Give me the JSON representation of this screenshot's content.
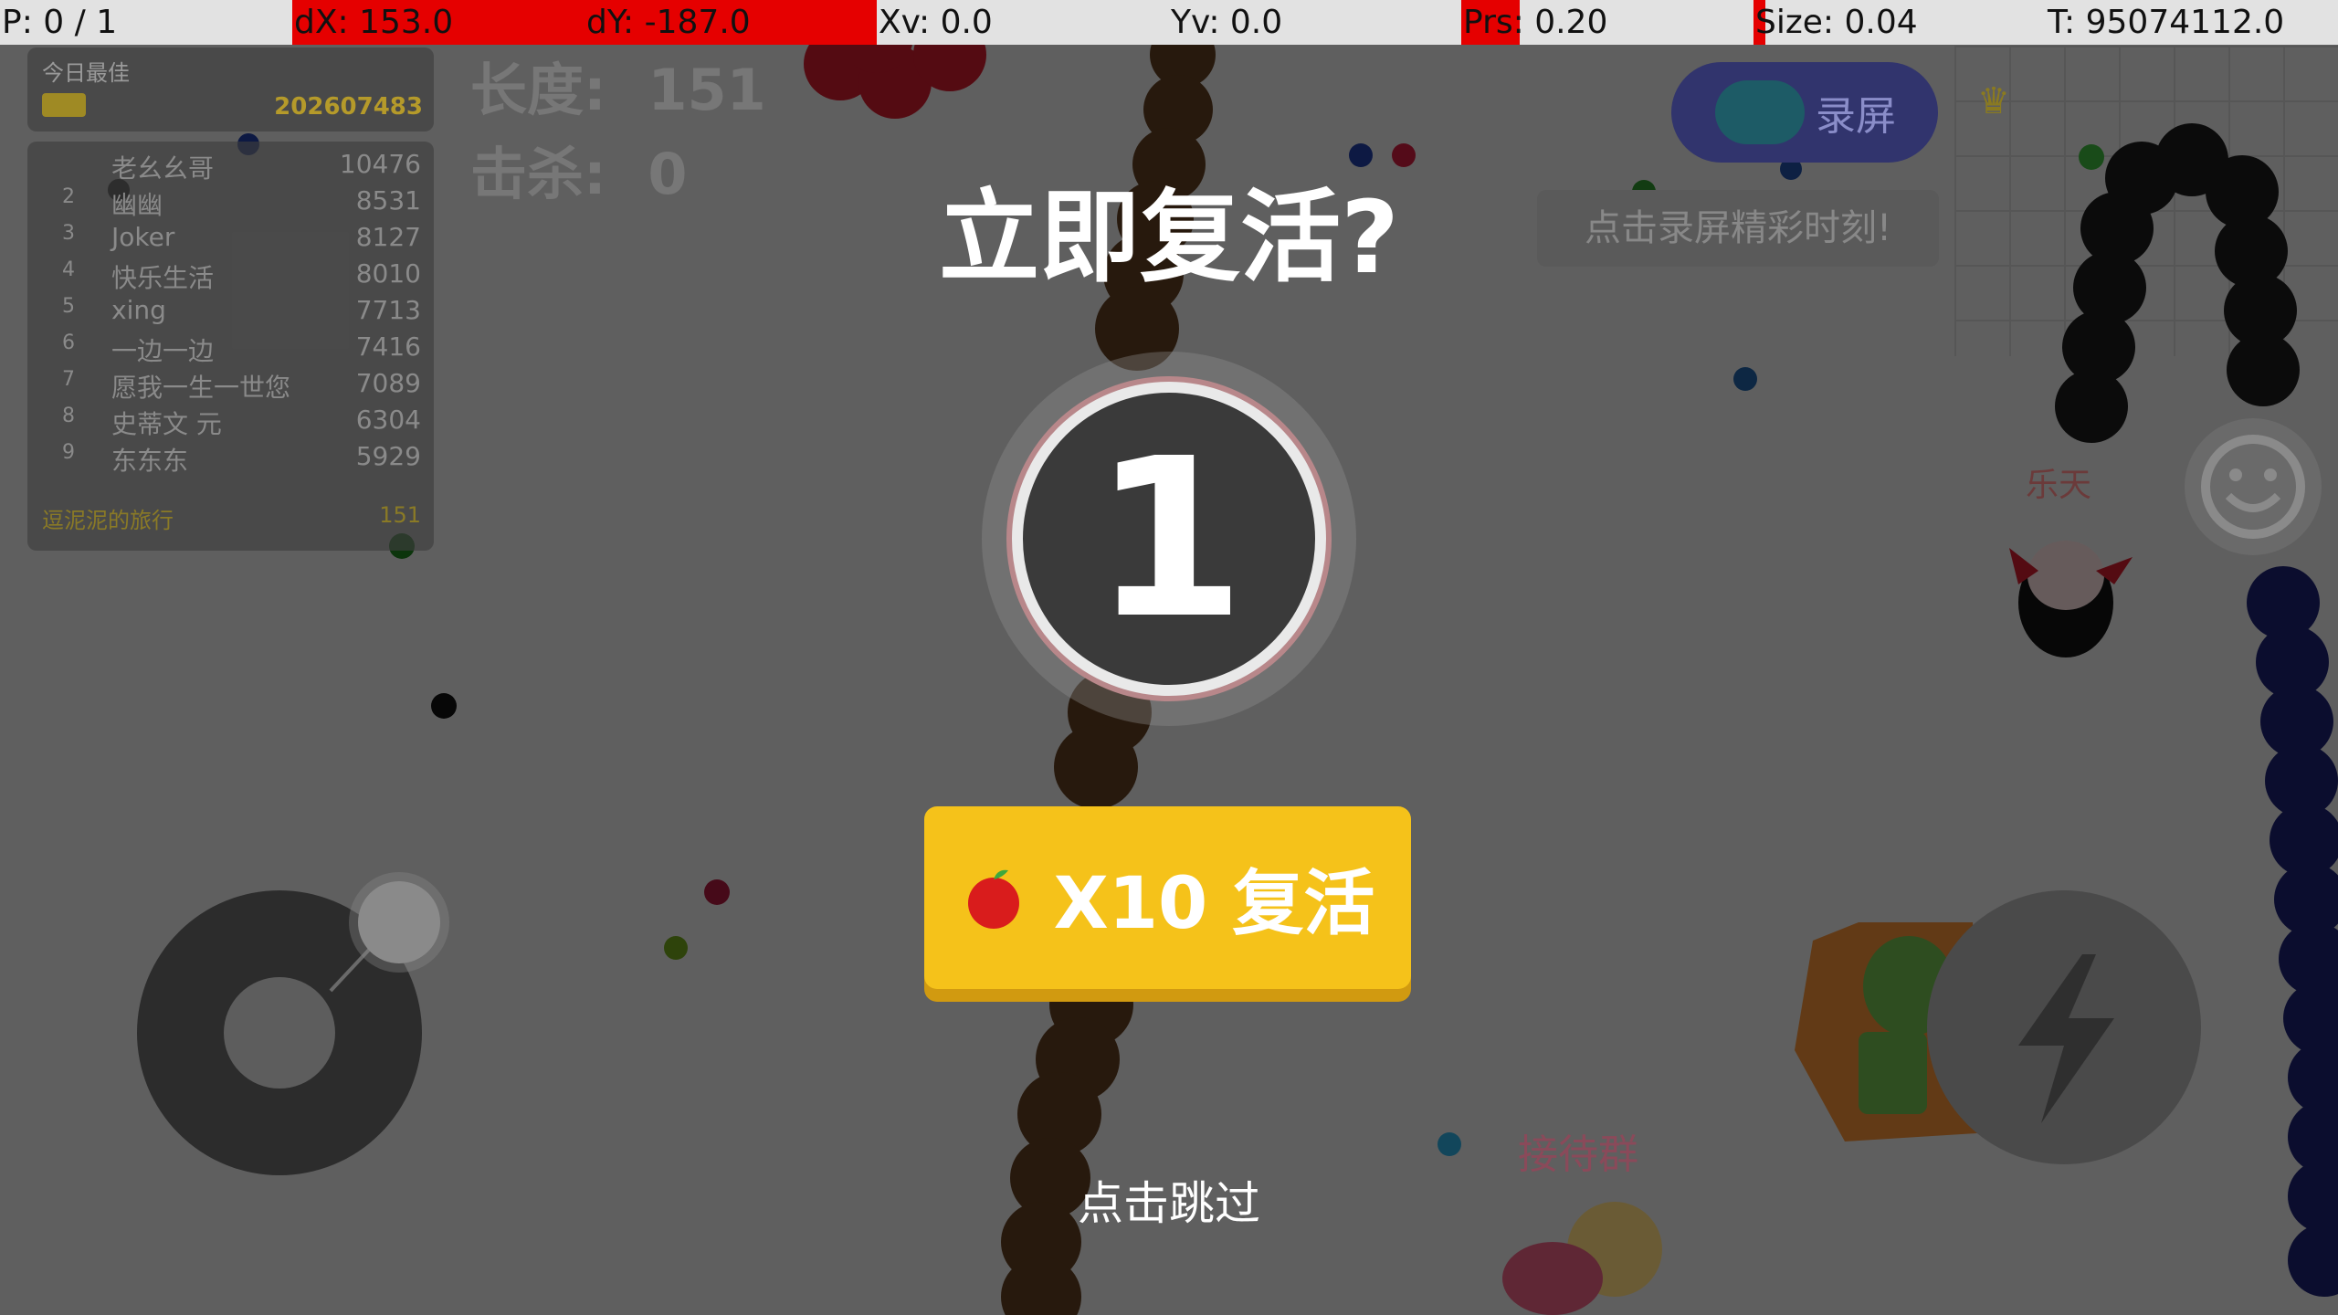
{
  "status_bar": [
    {
      "label": "P: 0 / 1",
      "fill": 0
    },
    {
      "label": "dX: 153.0",
      "fill": 1
    },
    {
      "label": "dY: -187.0",
      "fill": 1
    },
    {
      "label": "Xv: 0.0",
      "fill": 0
    },
    {
      "label": "Yv: 0.0",
      "fill": 0
    },
    {
      "label": "Prs: 0.20",
      "fill": 0.2
    },
    {
      "label": "Size: 0.04",
      "fill": 0.04
    },
    {
      "label": "T: 95074112.0",
      "fill": 0
    }
  ],
  "leaderboard": {
    "title": "今日最佳",
    "my_score": "202607483",
    "rows": [
      {
        "rank": "",
        "name": "老幺幺哥",
        "score": "10476"
      },
      {
        "rank": "2",
        "name": "幽幽",
        "score": "8531"
      },
      {
        "rank": "3",
        "name": "Joker",
        "score": "8127"
      },
      {
        "rank": "4",
        "name": "快乐生活",
        "score": "8010"
      },
      {
        "rank": "5",
        "name": "xing",
        "score": "7713"
      },
      {
        "rank": "6",
        "name": "一边一边",
        "score": "7416"
      },
      {
        "rank": "7",
        "name": "愿我一生一世您",
        "score": "7089"
      },
      {
        "rank": "8",
        "name": "史蒂文 元",
        "score": "6304"
      },
      {
        "rank": "9",
        "name": "东东东",
        "score": "5929"
      }
    ],
    "footer_name": "逗泥泥的旅行",
    "footer_score": "151"
  },
  "hud": {
    "length_label": "长度:",
    "length_value": "151",
    "kills_label": "击杀:",
    "kills_value": "0"
  },
  "dialog": {
    "title": "立即复活?",
    "countdown": "1",
    "revive_button": "X10 复活",
    "skip": "点击跳过"
  },
  "record": {
    "button": "录屏",
    "tip": "点击录屏精彩时刻!"
  },
  "group_label": "接待群",
  "player_tag": "乐天",
  "colors": {
    "revive_button": "#f5c21a",
    "status_fill": "#e50000",
    "overlay": "rgba(0,0,0,0.56)"
  }
}
